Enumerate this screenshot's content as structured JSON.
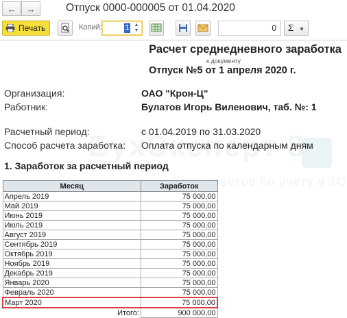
{
  "window": {
    "title": "Отпуск 0000-000005 от 01.04.2020",
    "back_icon": "arrow-left-icon",
    "forward_icon": "arrow-right-icon"
  },
  "toolbar": {
    "print_label": "Печать",
    "copies_label": "Копий:",
    "copies_value": "1",
    "sum_value": "0",
    "sum_button_label": "Σ"
  },
  "document": {
    "title": "Расчет среднедневного заработка",
    "subtitle": "к документу",
    "reference": "Отпуск №5 от 1 апреля 2020 г.",
    "organization_label": "Организация:",
    "organization_value": "ОАО \"Крон-Ц\"",
    "employee_label": "Работник:",
    "employee_value": "Булатов Игорь Виленович, таб. №: 1",
    "period_label": "Расчетный период:",
    "period_value": "с 01.04.2019 по 31.03.2020",
    "method_label": "Способ расчета заработка:",
    "method_value": "Оплата отпуска по календарным дням",
    "section_title": "1. Заработок за расчетный период",
    "watermark": "БухЭксперт 8",
    "watermark_sub": "База ответов по учёту в 1С"
  },
  "table": {
    "headers": [
      "Месяц",
      "Заработок"
    ],
    "rows": [
      [
        "Апрель 2019",
        "75 000,00"
      ],
      [
        "Май 2019",
        "75 000,00"
      ],
      [
        "Июнь 2019",
        "75 000,00"
      ],
      [
        "Июль 2019",
        "75 000,00"
      ],
      [
        "Август 2019",
        "75 000,00"
      ],
      [
        "Сентябрь 2019",
        "75 000,00"
      ],
      [
        "Октябрь 2019",
        "75 000,00"
      ],
      [
        "Ноябрь 2019",
        "75 000,00"
      ],
      [
        "Декабрь 2019",
        "75 000,00"
      ],
      [
        "Январь 2020",
        "75 000,00"
      ],
      [
        "Февраль 2020",
        "75 000,00"
      ],
      [
        "Март 2020",
        "75 000,00"
      ]
    ],
    "total_label": "Итого:",
    "total_value": "900 000,00",
    "highlight_color": "#d64040"
  },
  "colors": {
    "print_button": "#f5de3c",
    "header_bg": "#dfe6ec"
  }
}
